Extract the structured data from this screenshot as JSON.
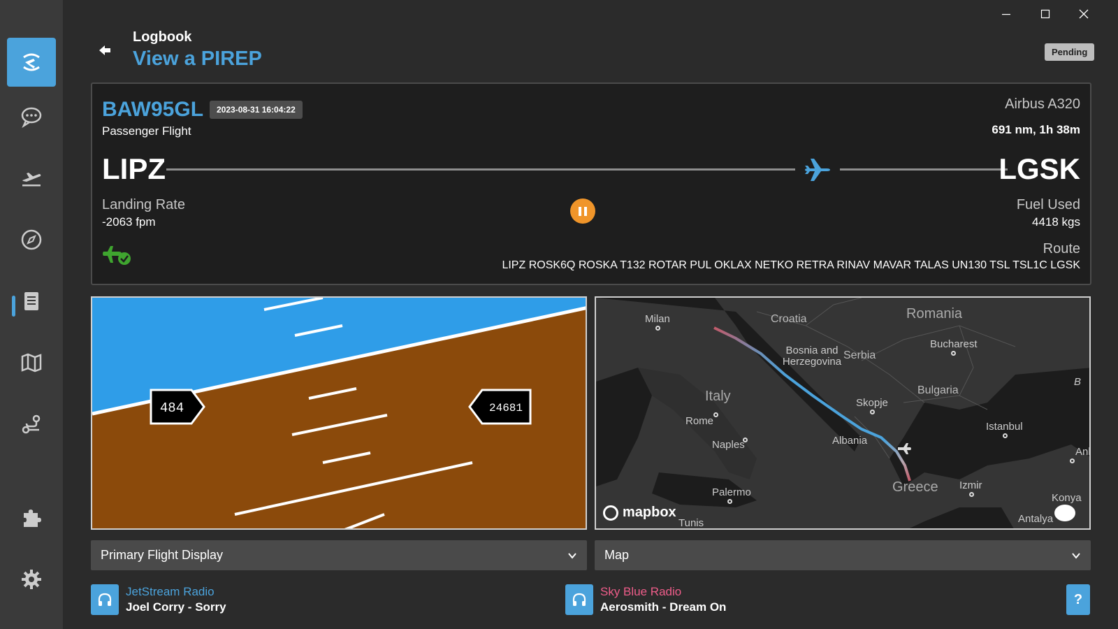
{
  "window": {
    "minimize_icon": "minimize-icon",
    "maximize_icon": "maximize-icon",
    "close_icon": "close-icon"
  },
  "sidebar": {
    "items": [
      {
        "name": "dashboard",
        "icon": "live-flight-icon",
        "active": true
      },
      {
        "name": "chat",
        "icon": "chat-icon",
        "active": false
      },
      {
        "name": "departures",
        "icon": "takeoff-icon",
        "active": false
      },
      {
        "name": "explore",
        "icon": "compass-icon",
        "active": false
      },
      {
        "name": "logbook",
        "icon": "book-icon",
        "active": false,
        "selected": true
      },
      {
        "name": "map",
        "icon": "map-icon",
        "active": false
      },
      {
        "name": "routes",
        "icon": "route-icon",
        "active": false
      },
      {
        "name": "plugins",
        "icon": "puzzle-icon",
        "active": false
      },
      {
        "name": "settings",
        "icon": "gear-icon",
        "active": false
      }
    ]
  },
  "header": {
    "breadcrumb": "Logbook",
    "title": "View a PIREP",
    "status": "Pending"
  },
  "pirep": {
    "callsign": "BAW95GL",
    "timestamp": "2023-08-31 16:04:22",
    "flight_type": "Passenger Flight",
    "aircraft": "Airbus A320",
    "distance_time": "691 nm, 1h 38m",
    "departure": "LIPZ",
    "arrival": "LGSK",
    "landing_rate_label": "Landing Rate",
    "landing_rate": "-2063 fpm",
    "fuel_label": "Fuel Used",
    "fuel": "4418 kgs",
    "route_label": "Route",
    "route": "LIPZ ROSK6Q ROSKA T132 ROTAR PUL OKLAX NETKO RETRA RINAV MAVAR TALAS UN130 TSL TSL1C LGSK"
  },
  "pfd": {
    "speed": "484",
    "altitude": "24681",
    "sky_color": "#2f9de8",
    "ground_color": "#8b4a0b"
  },
  "map": {
    "labels": {
      "romania": "Romania",
      "croatia": "Croatia",
      "milan": "Milan",
      "bucharest": "Bucharest",
      "bosnia": "Bosnia and Herzegovina",
      "serbia": "Serbia",
      "italy": "Italy",
      "bulgaria": "Bulgaria",
      "skopje": "Skopje",
      "rome": "Rome",
      "istanbul": "Istanbul",
      "albania": "Albania",
      "naples": "Naples",
      "anka": "Anka",
      "greece": "Greece",
      "izmir": "Izmir",
      "palermo": "Palermo",
      "konya": "Konya",
      "antalya": "Antalya",
      "tunis": "Tunis",
      "edge_b": "B"
    },
    "attribution": "mapbox"
  },
  "selects": {
    "left": "Primary Flight Display",
    "right": "Map"
  },
  "radios": [
    {
      "station": "JetStream Radio",
      "song": "Joel Corry - Sorry",
      "color": "#4ba3dc"
    },
    {
      "station": "Sky Blue Radio",
      "song": "Aerosmith - Dream On",
      "color": "#ef5d8a"
    }
  ],
  "help": {
    "label": "?"
  },
  "colors": {
    "accent": "#4ba3dc",
    "pause": "#f0952a",
    "landed": "#3fa52f"
  }
}
